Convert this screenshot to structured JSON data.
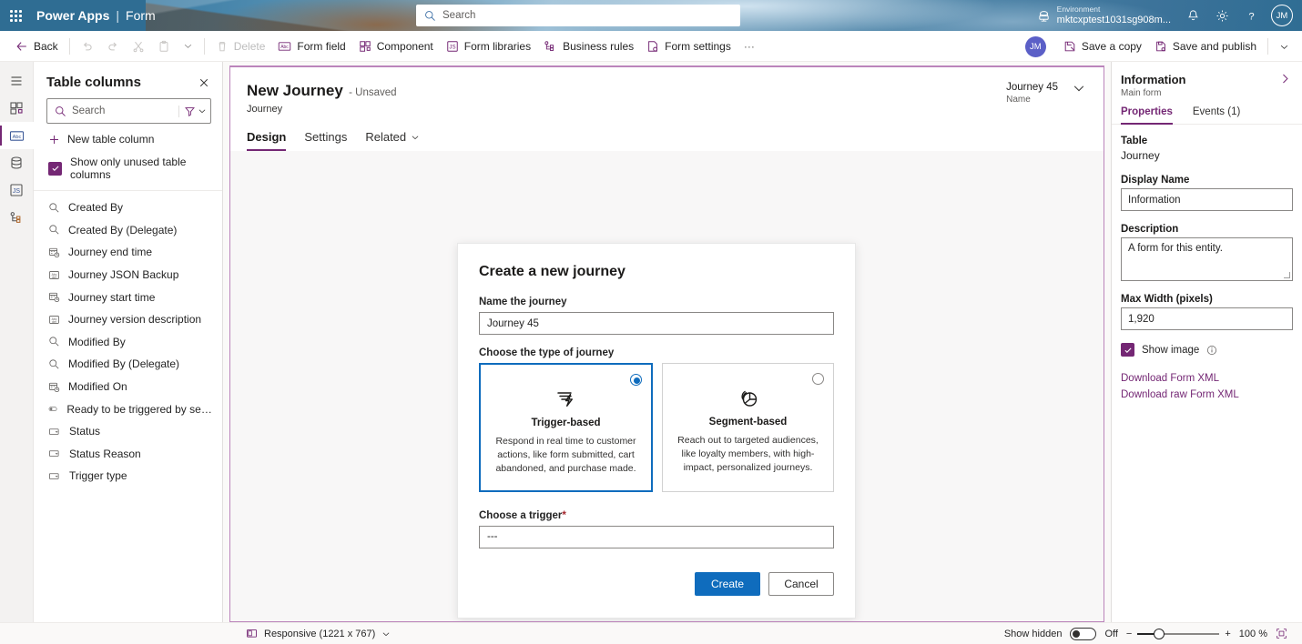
{
  "topbar": {
    "waffle": "app-launcher",
    "app_name": "Power Apps",
    "separator": "|",
    "module_name": "Form",
    "search_placeholder": "Search",
    "environment_label": "Environment",
    "environment_name": "mktcxptest1031sg908m...",
    "notifications_icon": "bell-icon",
    "settings_icon": "gear-icon",
    "help_icon": "question-icon",
    "avatar_initials": "JM"
  },
  "commandbar": {
    "back": "Back",
    "undo": "undo-icon",
    "redo": "redo-icon",
    "cut": "cut-icon",
    "paste": "paste-icon",
    "more_chevron": "chevron-down-icon",
    "delete": "Delete",
    "form_field": "Form field",
    "component": "Component",
    "form_libraries": "Form libraries",
    "business_rules": "Business rules",
    "form_settings": "Form settings",
    "overflow": "···",
    "avatar_initials": "JM",
    "save_a_copy": "Save a copy",
    "save_and_publish": "Save and publish"
  },
  "rail": {
    "items": [
      {
        "name": "hamburger-menu",
        "active": false
      },
      {
        "name": "components",
        "active": false
      },
      {
        "name": "table-columns",
        "active": true
      },
      {
        "name": "data-source",
        "active": false
      },
      {
        "name": "form-libraries",
        "active": false
      },
      {
        "name": "business-rules",
        "active": false
      }
    ]
  },
  "table_columns_panel": {
    "title": "Table columns",
    "close_icon": "close-icon",
    "search_placeholder": "Search",
    "filter_icon": "filter-icon",
    "new_column": "New table column",
    "show_only_unused": "Show only unused table columns",
    "show_only_unused_checked": true,
    "columns": [
      {
        "label": "Created By",
        "icon": "lookup-icon"
      },
      {
        "label": "Created By (Delegate)",
        "icon": "lookup-icon"
      },
      {
        "label": "Journey end time",
        "icon": "datetime-icon"
      },
      {
        "label": "Journey JSON Backup",
        "icon": "text-icon"
      },
      {
        "label": "Journey start time",
        "icon": "datetime-icon"
      },
      {
        "label": "Journey version description",
        "icon": "text-icon"
      },
      {
        "label": "Modified By",
        "icon": "lookup-icon"
      },
      {
        "label": "Modified By (Delegate)",
        "icon": "lookup-icon"
      },
      {
        "label": "Modified On",
        "icon": "datetime-icon"
      },
      {
        "label": "Ready to be triggered by segment r...",
        "icon": "toggle-icon"
      },
      {
        "label": "Status",
        "icon": "choice-icon"
      },
      {
        "label": "Status Reason",
        "icon": "choice-icon"
      },
      {
        "label": "Trigger type",
        "icon": "choice-icon"
      }
    ]
  },
  "form_header": {
    "title": "New Journey",
    "unsaved": "- Unsaved",
    "table": "Journey",
    "record_value": "Journey 45",
    "record_label": "Name",
    "chevron_icon": "chevron-down-icon",
    "tabs": [
      {
        "label": "Design",
        "active": true,
        "has_chevron": false
      },
      {
        "label": "Settings",
        "active": false,
        "has_chevron": false
      },
      {
        "label": "Related",
        "active": false,
        "has_chevron": true
      }
    ]
  },
  "dialog": {
    "title": "Create a new journey",
    "name_label": "Name the journey",
    "name_value": "Journey 45",
    "type_label": "Choose the type of journey",
    "cards": [
      {
        "title": "Trigger-based",
        "description": "Respond in real time to customer actions, like form submitted, cart abandoned, and purchase made.",
        "icon": "trigger-lightning-icon",
        "selected": true
      },
      {
        "title": "Segment-based",
        "description": "Reach out to targeted audiences, like loyalty members, with high-impact, personalized journeys.",
        "icon": "segment-pie-icon",
        "selected": false
      }
    ],
    "trigger_label": "Choose a trigger",
    "trigger_required": "*",
    "trigger_value": "---",
    "create_button": "Create",
    "cancel_button": "Cancel"
  },
  "properties_panel": {
    "title": "Information",
    "subtitle": "Main form",
    "expand_icon": "chevron-right-icon",
    "tabs": [
      {
        "label": "Properties",
        "active": true
      },
      {
        "label": "Events (1)",
        "active": false
      }
    ],
    "table_label": "Table",
    "table_value": "Journey",
    "display_name_label": "Display Name",
    "display_name_value": "Information",
    "description_label": "Description",
    "description_value": "A form for this entity.",
    "max_width_label": "Max Width (pixels)",
    "max_width_value": "1,920",
    "show_image_label": "Show image",
    "show_image_checked": true,
    "info_icon": "info-icon",
    "download_form_xml": "Download Form XML",
    "download_raw_form_xml": "Download raw Form XML"
  },
  "statusbar": {
    "responsive_icon": "device-icon",
    "responsive_label": "Responsive (1221 x 767)",
    "responsive_chevron": "chevron-down-icon",
    "show_hidden_label": "Show hidden",
    "show_hidden_state": "Off",
    "zoom_minus": "−",
    "zoom_plus": "+",
    "zoom_value": "100 %",
    "fit_icon": "fit-to-screen-icon"
  },
  "colors": {
    "brand_purple": "#742774",
    "header_blue": "#2f6d93",
    "accent_blue": "#0f6cbd",
    "required_red": "#a4262c"
  }
}
